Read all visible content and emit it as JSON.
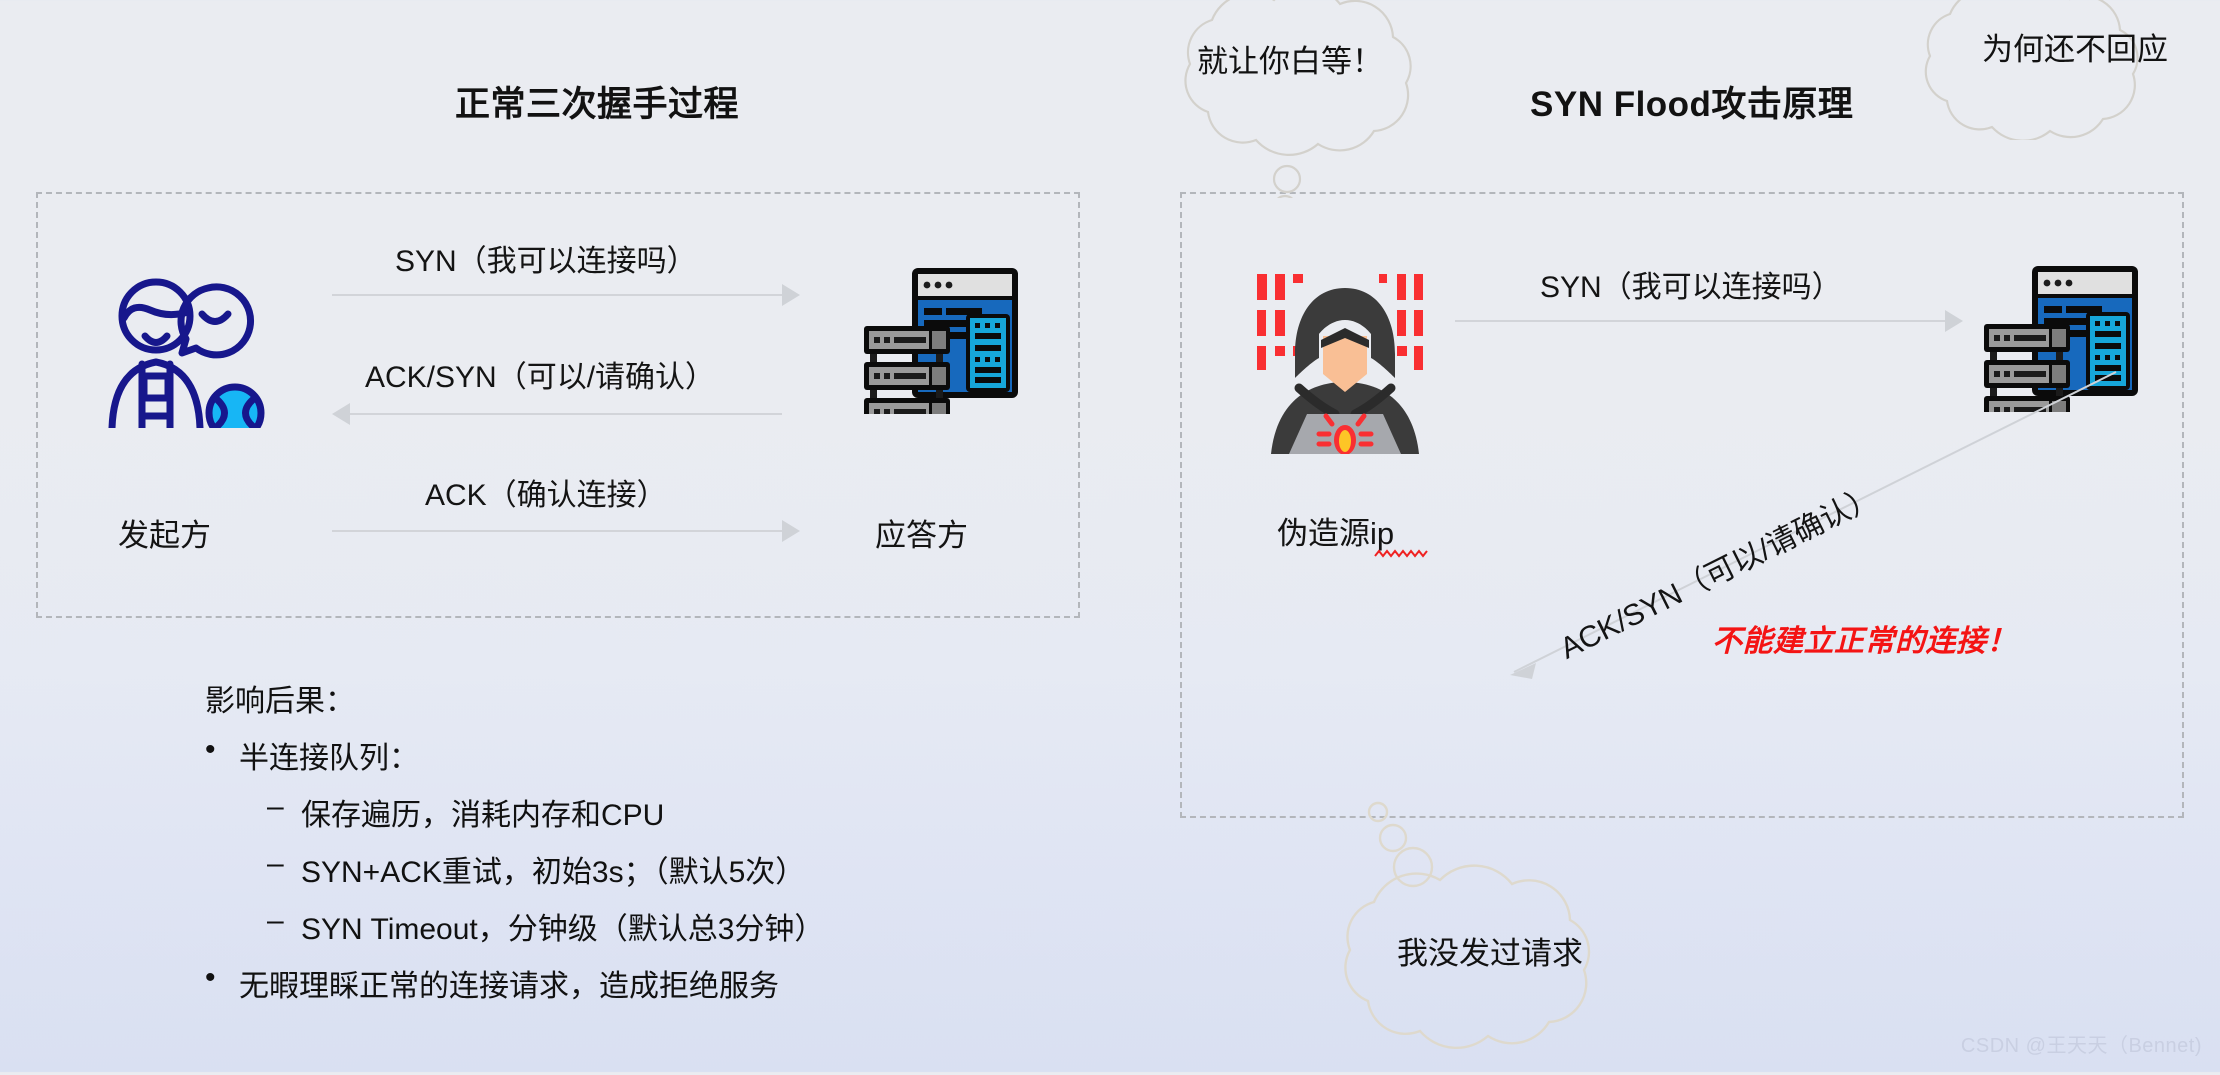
{
  "slide": {
    "left_panel": {
      "title": "正常三次握手过程",
      "initiator_label": "发起方",
      "responder_label": "应答方",
      "messages": [
        {
          "text": "SYN（我可以连接吗）",
          "direction": "right"
        },
        {
          "text": "ACK/SYN（可以/请确认）",
          "direction": "left"
        },
        {
          "text": "ACK（确认连接）",
          "direction": "right"
        }
      ]
    },
    "right_panel": {
      "title": "SYN Flood攻击原理",
      "attacker_label": "伪造源ip",
      "messages": [
        {
          "text": "SYN（我可以连接吗）",
          "direction": "right"
        },
        {
          "text": "ACK/SYN（可以/请确认）",
          "direction": "diagonal-down-left"
        }
      ],
      "warning": "不能建立正常的连接！"
    },
    "thought_bubbles": [
      {
        "id": "attacker-thought",
        "text": "就让你白等！"
      },
      {
        "id": "server-thought",
        "text": "为何还不回应"
      },
      {
        "id": "victim-thought",
        "text": "我没发过请求"
      }
    ],
    "consequences": {
      "heading": "影响后果：",
      "items": [
        {
          "level": 1,
          "bullet": "•",
          "text": "半连接队列："
        },
        {
          "level": 2,
          "bullet": "–",
          "text": "保存遍历，消耗内存和CPU"
        },
        {
          "level": 2,
          "bullet": "–",
          "text": "SYN+ACK重试，初始3s；（默认5次）"
        },
        {
          "level": 2,
          "bullet": "–",
          "text": "SYN Timeout，分钟级（默认总3分钟）"
        },
        {
          "level": 1,
          "bullet": "•",
          "text": "无暇理睬正常的连接请求，造成拒绝服务"
        }
      ]
    },
    "watermark": "CSDN @王天天（Bennet)",
    "colors": {
      "accent_blue": "#1769bd",
      "server_cyan": "#16a6d9",
      "person_navy": "#1a1a8c",
      "person_cyan": "#17b6f5",
      "hacker_dark": "#3b3b3b",
      "hacker_red": "#f92f32",
      "warning_red": "#f41414",
      "dashed_border": "#b3b6bb",
      "arrow_gray": "#d2d4d9",
      "watermark_gray": "#c9cfe2"
    },
    "icons": {
      "initiator": "people-chat-icon",
      "responder": "server-rack-icon",
      "attacker": "hacker-hoodie-laptop-icon",
      "victim_server": "server-rack-icon"
    }
  }
}
